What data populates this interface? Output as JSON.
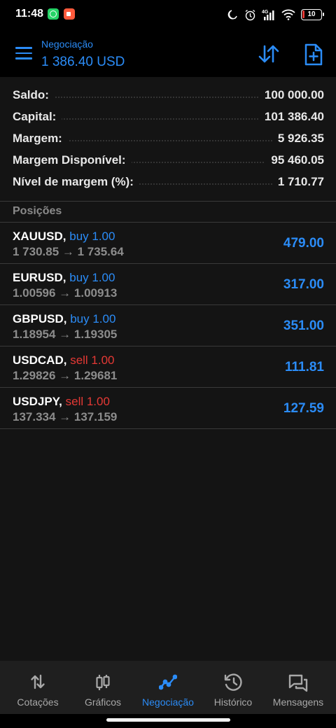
{
  "status_bar": {
    "time": "11:48",
    "battery": "10",
    "network": "4G",
    "apps": [
      "whatsapp-icon",
      "screen-recorder-icon"
    ],
    "icons": [
      "moon-icon",
      "alarm-icon",
      "signal-icon",
      "wifi-icon",
      "battery-icon"
    ]
  },
  "header": {
    "subtitle": "Negociação",
    "title": "1 386.40 USD",
    "accent_color": "#2b8cf7"
  },
  "summary": [
    {
      "label": "Saldo:",
      "value": "100 000.00"
    },
    {
      "label": "Capital:",
      "value": "101 386.40"
    },
    {
      "label": "Margem:",
      "value": "5 926.35"
    },
    {
      "label": "Margem Disponível:",
      "value": "95 460.05"
    },
    {
      "label": "Nível de margem (%):",
      "value": "1 710.77"
    }
  ],
  "positions_header": "Posições",
  "positions": [
    {
      "symbol": "XAUUSD,",
      "side": "buy 1.00",
      "side_type": "buy",
      "prices": "1 730.85 → 1 735.64",
      "profit": "479.00"
    },
    {
      "symbol": "EURUSD,",
      "side": "buy 1.00",
      "side_type": "buy",
      "prices": "1.00596 → 1.00913",
      "profit": "317.00"
    },
    {
      "symbol": "GBPUSD,",
      "side": "buy 1.00",
      "side_type": "buy",
      "prices": "1.18954 → 1.19305",
      "profit": "351.00"
    },
    {
      "symbol": "USDCAD,",
      "side": "sell 1.00",
      "side_type": "sell",
      "prices": "1.29826 → 1.29681",
      "profit": "111.81"
    },
    {
      "symbol": "USDJPY,",
      "side": "sell 1.00",
      "side_type": "sell",
      "prices": "137.334 → 137.159",
      "profit": "127.59"
    }
  ],
  "colors": {
    "buy": "#2b8cf7",
    "sell": "#e53935",
    "profit": "#2b8cf7"
  },
  "bottom_nav": [
    {
      "label": "Cotações",
      "icon": "quotes-arrows-icon",
      "active": false
    },
    {
      "label": "Gráficos",
      "icon": "candlestick-chart-icon",
      "active": false
    },
    {
      "label": "Negociação",
      "icon": "trade-line-icon",
      "active": true
    },
    {
      "label": "Histórico",
      "icon": "history-clock-icon",
      "active": false
    },
    {
      "label": "Mensagens",
      "icon": "messages-icon",
      "active": false
    }
  ]
}
